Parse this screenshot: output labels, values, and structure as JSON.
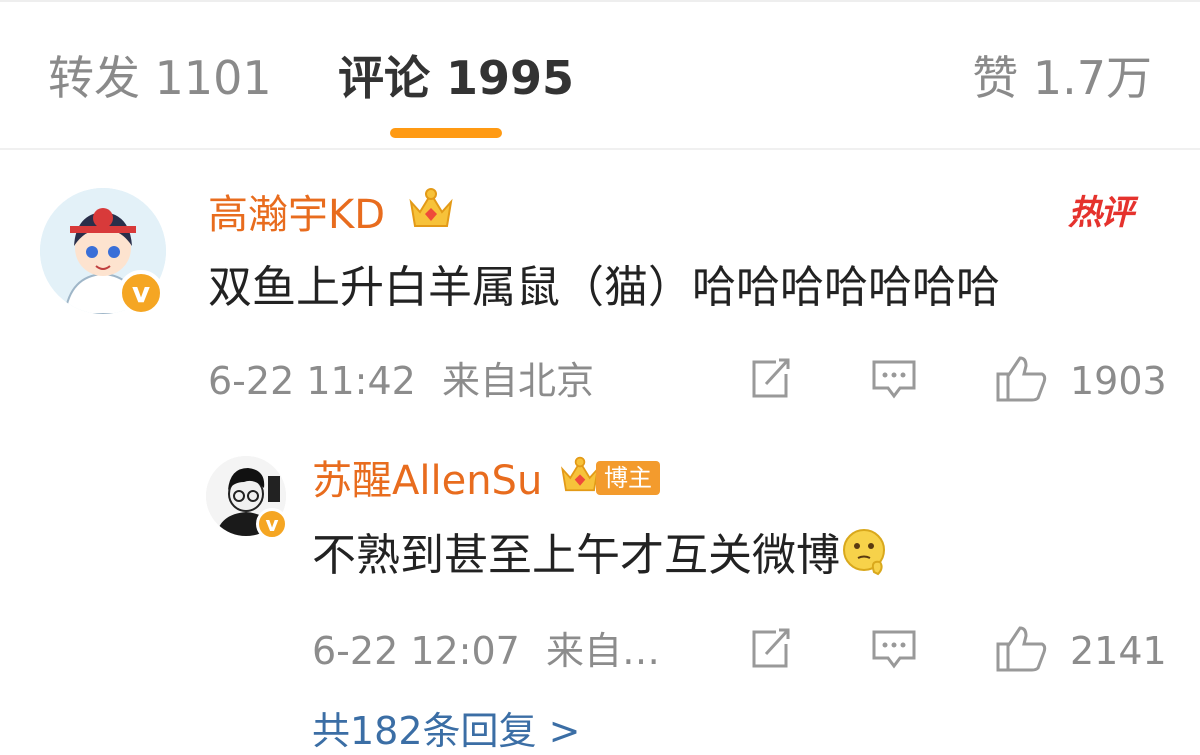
{
  "tabs": {
    "repost": "转发 1101",
    "comment": "评论 1995",
    "like": "赞 1.7万"
  },
  "comments": [
    {
      "username": "高瀚宇KD",
      "text": "双鱼上升白羊属鼠（猫）哈哈哈哈哈哈哈",
      "time": "6-22 11:42",
      "location": "来自北京",
      "likes": "1903",
      "hot_badge": "热评",
      "verified_mark": "v"
    }
  ],
  "reply": {
    "username": "苏醒AllenSu",
    "tag": "博主",
    "text": "不熟到甚至上午才互关微博",
    "time": "6-22 12:07",
    "location": "来自…",
    "likes": "2141",
    "verified_mark": "v"
  },
  "more_replies": "共182条回复 >",
  "icons": [
    "repost-icon",
    "comment-icon",
    "like-icon",
    "crown-icon"
  ],
  "colors": {
    "accent": "#ff9a13",
    "username": "#e86c1e",
    "hot": "#e5322d"
  }
}
